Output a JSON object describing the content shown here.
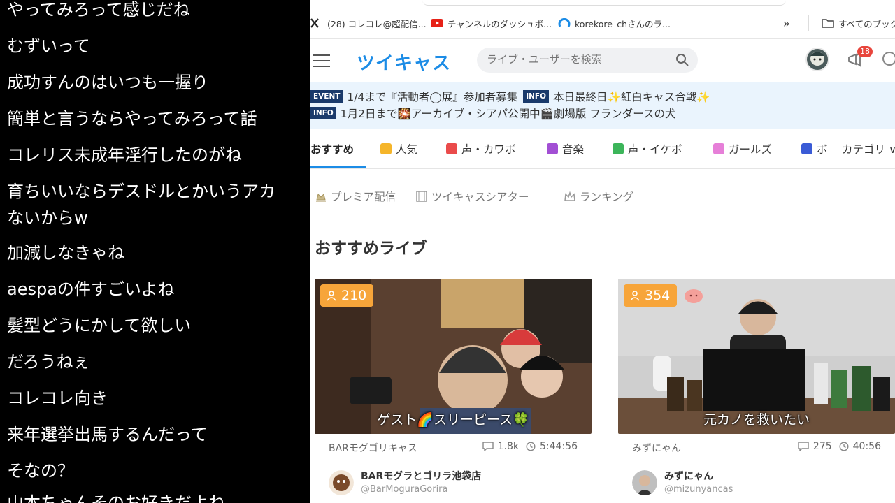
{
  "comments": [
    "やってみろって感じだね",
    "むずいって",
    "成功すんのはいつも一握り",
    "簡単と言うならやってみろって話",
    "コレリス未成年淫行したのがね",
    "育ちいいならデスドルとかいうアカ",
    "ないからw",
    "加減しなきゃね",
    "aespaの件すごいよね",
    "髪型どうにかして欲しい",
    "だろうねぇ",
    "コレコレ向き",
    "来年選挙出馬するんだって",
    "そなの？",
    "山本ちゃんそのお好きだよね"
  ],
  "bookmarks": [
    {
      "label": "(28) コレコレ@超配信...",
      "icon": "x-icon"
    },
    {
      "label": "チャンネルのダッシュボ...",
      "icon": "youtube-icon"
    },
    {
      "label": "korekore_chさんのラ...",
      "icon": "twitcasting-icon"
    },
    {
      "label": "»",
      "icon": ""
    },
    {
      "label": "すべてのブック",
      "icon": "folder-icon"
    }
  ],
  "header": {
    "logo": "ツイキャス",
    "search_placeholder": "ライブ・ユーザーを検索",
    "notification_count": "18"
  },
  "news": [
    {
      "tag": "EVENT",
      "text": "1/4まで『活動者◯展』参加者募集",
      "tag2": "INFO",
      "text2": "本日最終日✨紅白キャス合戦✨"
    },
    {
      "tag": "INFO",
      "text": "1月2日まで🎇アーカイブ・シアパ公開中🎬劇場版 フランダースの犬"
    }
  ],
  "tabs": [
    {
      "label": "おすすめ",
      "color": ""
    },
    {
      "label": "人気",
      "color": "#f5b52a"
    },
    {
      "label": "声・カワボ",
      "color": "#ea4b4b"
    },
    {
      "label": "音楽",
      "color": "#a24fd4"
    },
    {
      "label": "声・イケボ",
      "color": "#3cb55a"
    },
    {
      "label": "ガールズ",
      "color": "#e67fd8"
    },
    {
      "label": "ボ",
      "color": "#3a5bd6"
    },
    {
      "label": "カテゴリ ∨",
      "color": ""
    }
  ],
  "subnav": [
    {
      "label": "プレミア配信",
      "icon": "crown-hat-icon"
    },
    {
      "label": "ツイキャスシアター",
      "icon": "film-icon"
    },
    {
      "label": "ランキング",
      "icon": "crown-icon"
    }
  ],
  "section_title": "おすすめライブ",
  "cards": [
    {
      "viewers": "210",
      "caption": "ゲスト🌈スリーピース🍀",
      "channel": "BARモグゴリキャス",
      "comments": "1.8k",
      "duration": "5:44:56",
      "user_name": "BARモグラとゴリラ池袋店",
      "user_id": "@BarMoguraGorira",
      "badge": ""
    },
    {
      "viewers": "354",
      "caption": "元カノを救いたい",
      "channel": "みずにゃん",
      "comments": "275",
      "duration": "40:56",
      "user_name": "みずにゃん",
      "user_id": "@mizunyancas",
      "badge": "blob-face-icon"
    }
  ]
}
